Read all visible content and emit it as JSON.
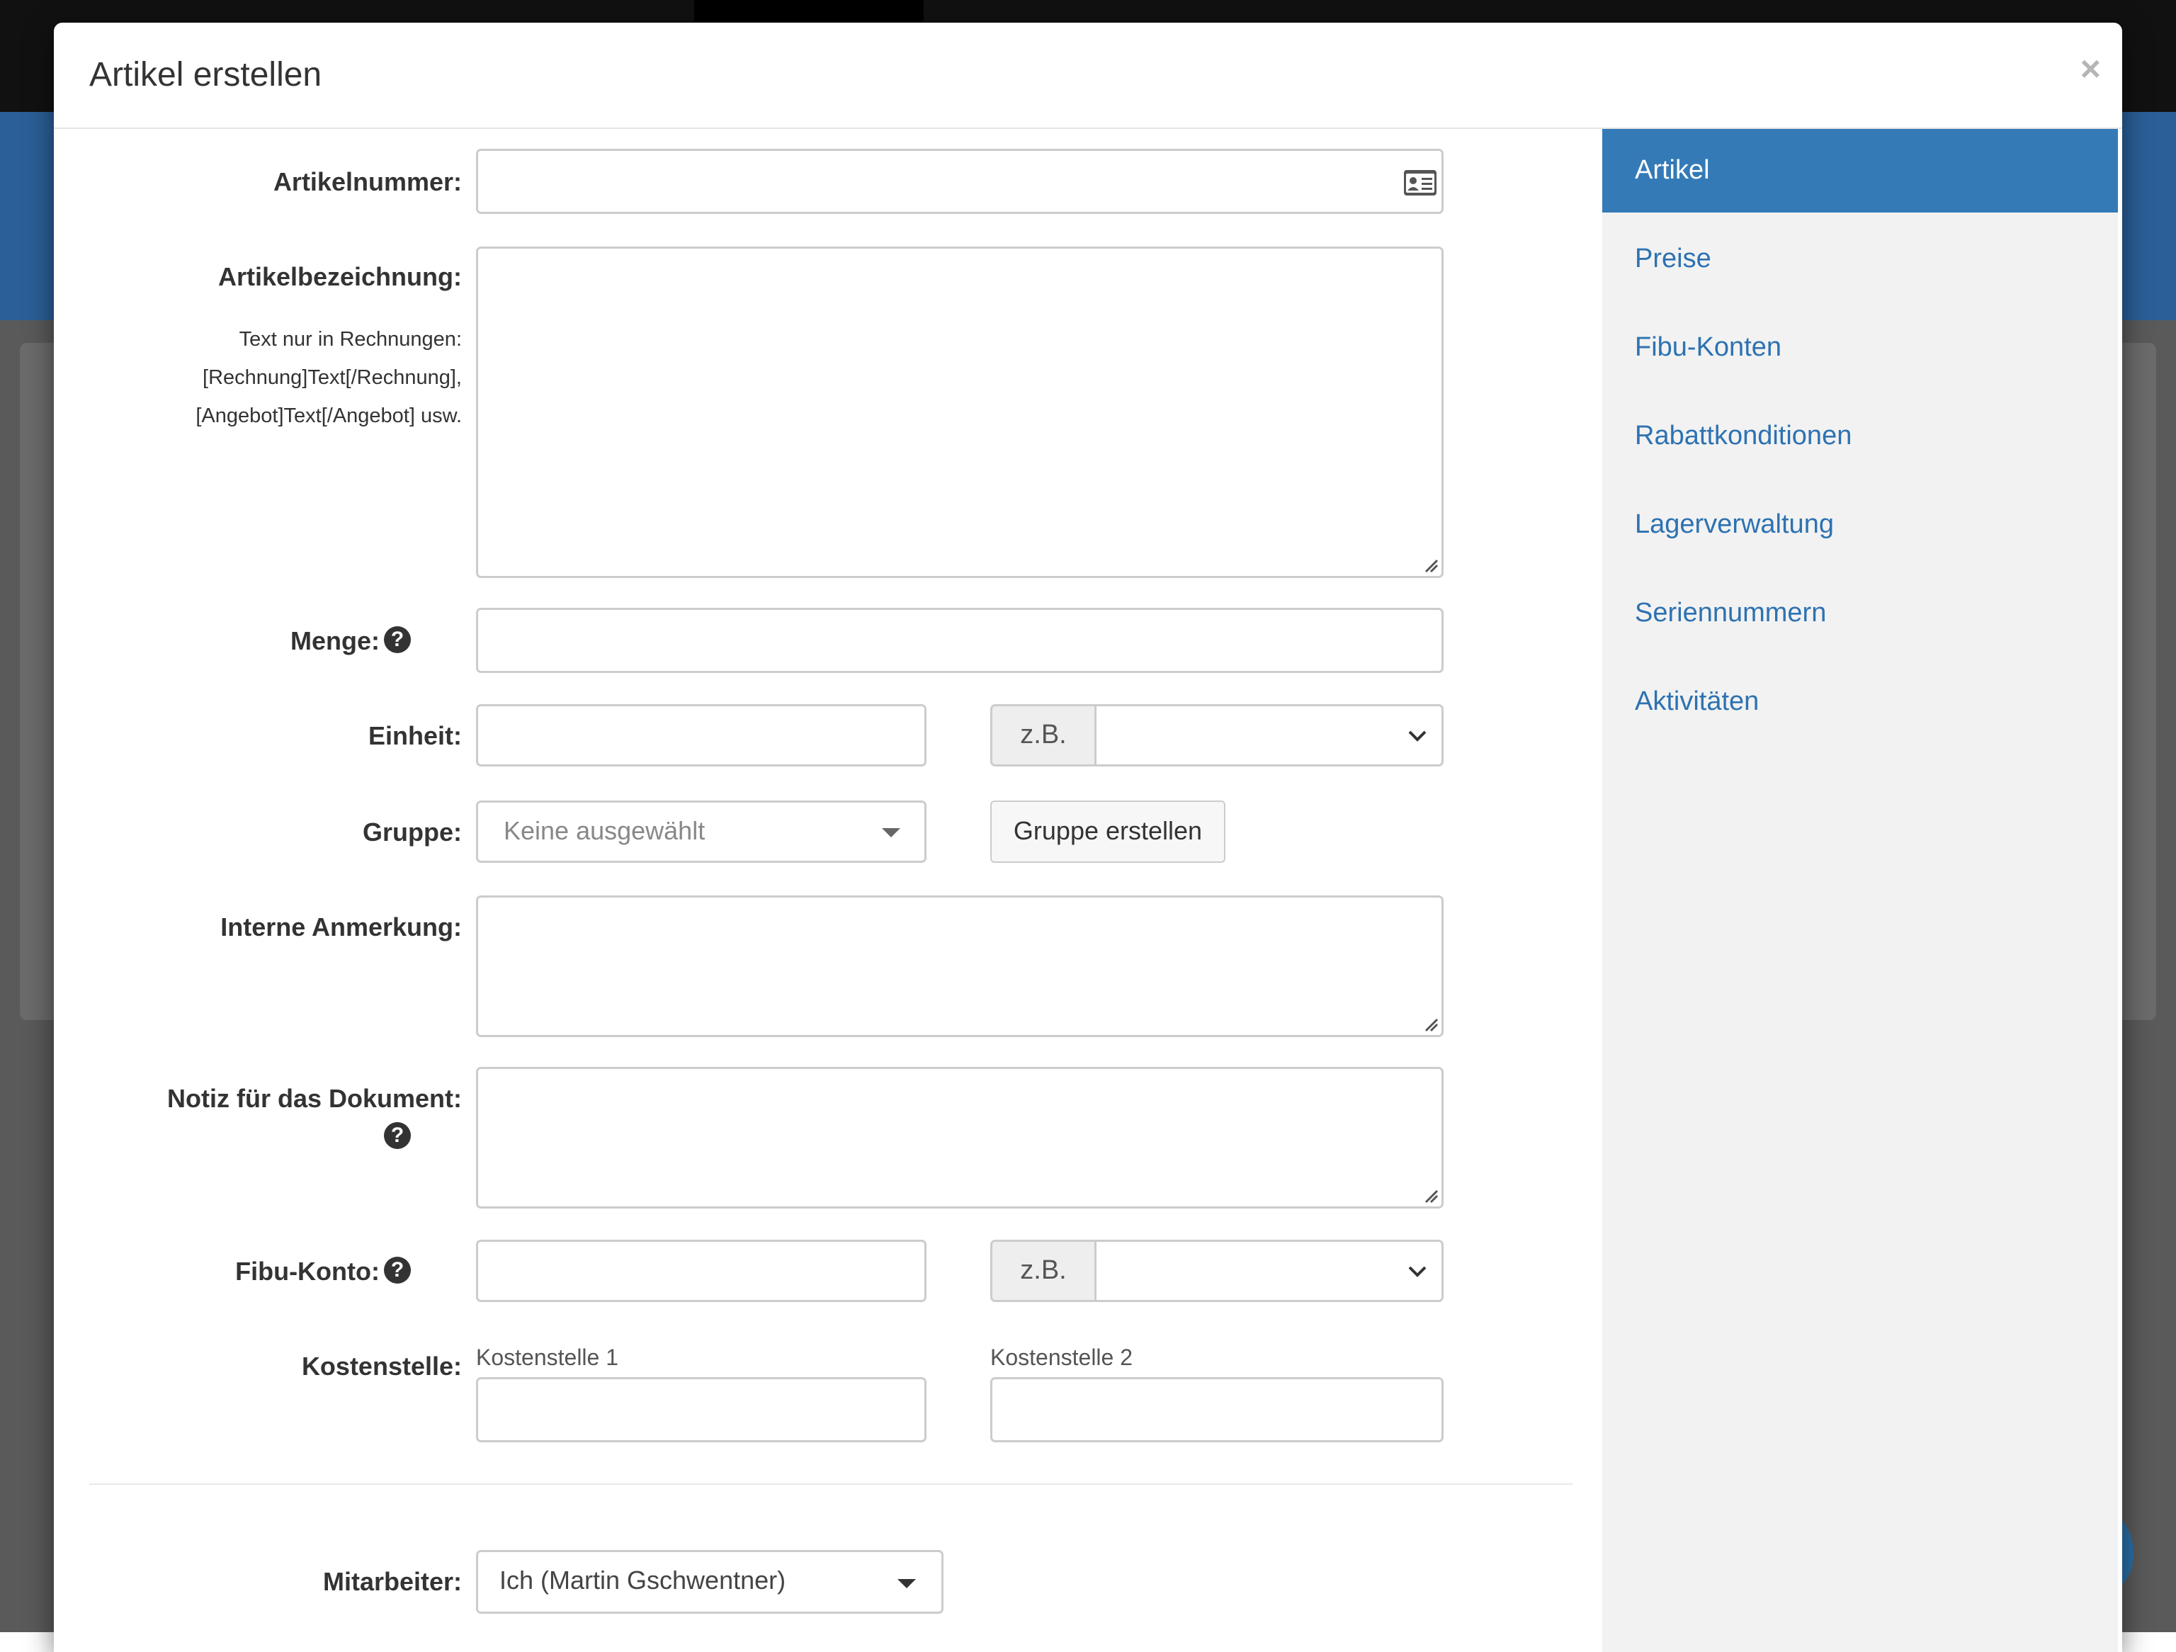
{
  "modal": {
    "title": "Artikel erstellen",
    "close": "×"
  },
  "nav": {
    "items": [
      {
        "label": "Artikel",
        "active": true
      },
      {
        "label": "Preise"
      },
      {
        "label": "Fibu-Konten"
      },
      {
        "label": "Rabattkonditionen"
      },
      {
        "label": "Lagerverwaltung"
      },
      {
        "label": "Seriennummern"
      },
      {
        "label": "Aktivitäten"
      }
    ]
  },
  "form": {
    "artikelnummer": {
      "label": "Artikelnummer:",
      "value": ""
    },
    "artikelbezeichnung": {
      "label": "Artikelbezeichnung:",
      "hint1": "Text nur in Rechnungen:",
      "hint2": "[Rechnung]Text[/Rechnung],",
      "hint3": "[Angebot]Text[/Angebot] usw.",
      "value": ""
    },
    "menge": {
      "label": "Menge:",
      "value": ""
    },
    "einheit": {
      "label": "Einheit:",
      "value": "",
      "addon": "z.B.",
      "select_value": ""
    },
    "gruppe": {
      "label": "Gruppe:",
      "dropdown": "Keine ausgewählt",
      "button": "Gruppe erstellen"
    },
    "interne_anmerkung": {
      "label": "Interne Anmerkung:",
      "value": ""
    },
    "notiz": {
      "label": "Notiz für das Dokument:",
      "value": ""
    },
    "fibu_konto": {
      "label": "Fibu-Konto:",
      "value": "",
      "addon": "z.B.",
      "select_value": ""
    },
    "kostenstelle": {
      "label": "Kostenstelle:",
      "sub1": "Kostenstelle 1",
      "sub2": "Kostenstelle 2"
    },
    "mitarbeiter": {
      "label": "Mitarbeiter:",
      "dropdown": "Ich (Martin Gschwentner)"
    }
  },
  "icons": {
    "help": "question-circle-icon",
    "id_card": "id-card-icon",
    "chevron": "chevron-down-icon"
  }
}
